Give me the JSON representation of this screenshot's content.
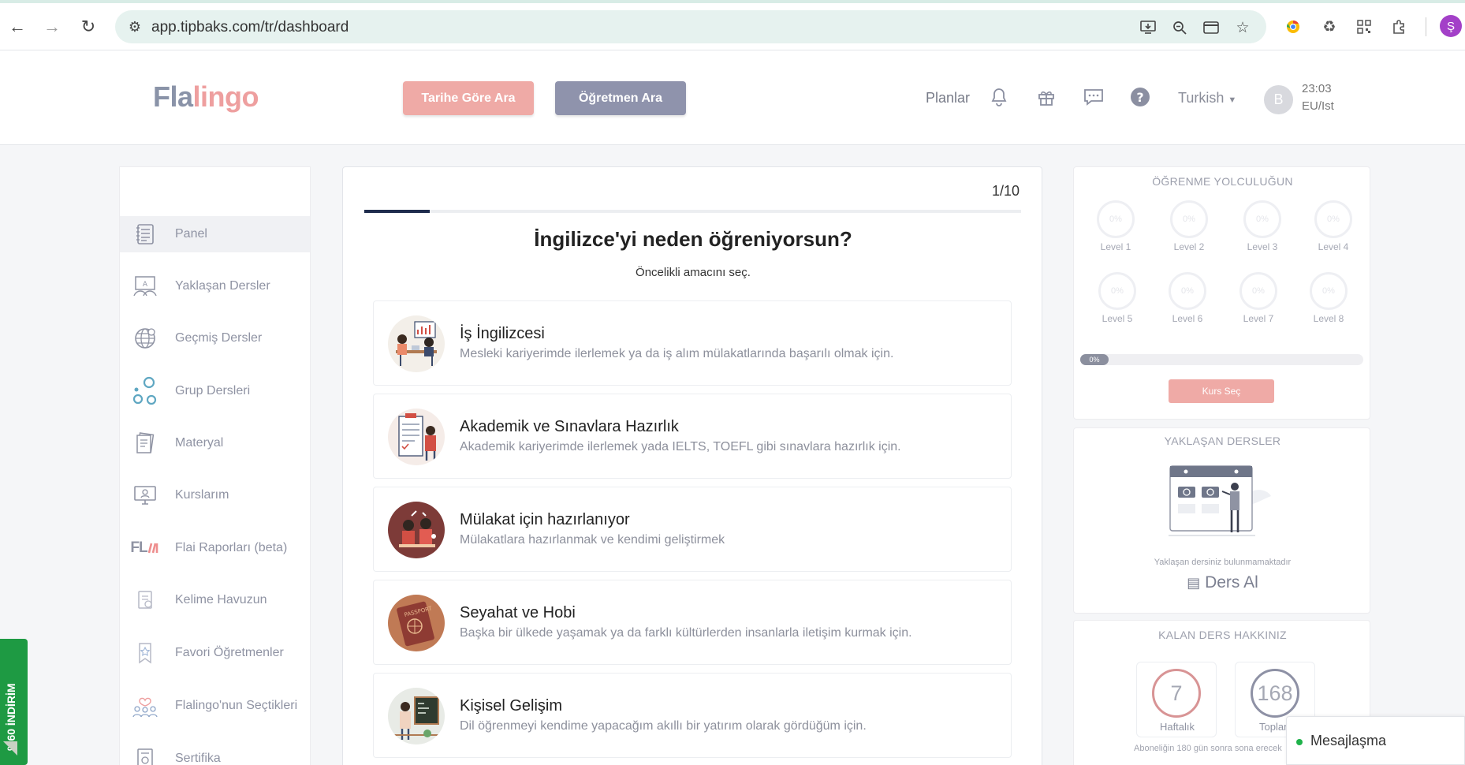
{
  "browser": {
    "url": "app.tipbaks.com/tr/dashboard",
    "profile_initial": "Ş"
  },
  "header": {
    "logo_part1": "Fla",
    "logo_part2": "lingo",
    "search_by_date": "Tarihe Göre Ara",
    "search_teacher": "Öğretmen Ara",
    "plans": "Planlar",
    "language": "Turkish",
    "avatar_initial": "B",
    "time": "23:03",
    "timezone": "EU/Ist"
  },
  "sidebar": {
    "items": [
      {
        "label": "Panel",
        "icon": "dashboard-icon"
      },
      {
        "label": "Yaklaşan Dersler",
        "icon": "upcoming-lessons-icon"
      },
      {
        "label": "Geçmiş Dersler",
        "icon": "past-lessons-icon"
      },
      {
        "label": "Grup Dersleri",
        "icon": "group-lessons-icon"
      },
      {
        "label": "Materyal",
        "icon": "material-icon"
      },
      {
        "label": "Kurslarım",
        "icon": "my-courses-icon"
      },
      {
        "label": "Flai Raporları (beta)",
        "icon": "flai-icon"
      },
      {
        "label": "Kelime Havuzun",
        "icon": "word-pool-icon"
      },
      {
        "label": "Favori Öğretmenler",
        "icon": "favorite-teachers-icon"
      },
      {
        "label": "Flalingo'nun Seçtikleri",
        "icon": "picks-icon"
      },
      {
        "label": "Sertifika",
        "icon": "certificate-icon"
      }
    ],
    "flai_logo_text": "FL"
  },
  "survey": {
    "counter": "1/10",
    "progress": 0.1,
    "question": "İngilizce'yi neden öğreniyorsun?",
    "subtitle": "Öncelikli amacını seç.",
    "options": [
      {
        "title": "İş İngilizcesi",
        "desc": "Mesleki kariyerimde ilerlemek ya da iş alım mülakatlarında başarılı olmak için."
      },
      {
        "title": "Akademik ve Sınavlara Hazırlık",
        "desc": "Akademik kariyerimde ilerlemek yada IELTS, TOEFL gibi sınavlara hazırlık için."
      },
      {
        "title": "Mülakat için hazırlanıyor",
        "desc": "Mülakatlara hazırlanmak ve kendimi geliştirmek"
      },
      {
        "title": "Seyahat ve Hobi",
        "desc": "Başka bir ülkede yaşamak ya da farklı kültürlerden insanlarla iletişim kurmak için."
      },
      {
        "title": "Kişisel Gelişim",
        "desc": "Dil öğrenmeyi kendime yapacağım akıllı bir yatırım olarak gördüğüm için."
      }
    ]
  },
  "journey": {
    "title": "ÖĞRENME YOLCULUĞUN",
    "levels": [
      {
        "label": "Level 1",
        "pct": "0%"
      },
      {
        "label": "Level 2",
        "pct": "0%"
      },
      {
        "label": "Level 3",
        "pct": "0%"
      },
      {
        "label": "Level 4",
        "pct": "0%"
      },
      {
        "label": "Level 5",
        "pct": "0%"
      },
      {
        "label": "Level 6",
        "pct": "0%"
      },
      {
        "label": "Level 7",
        "pct": "0%"
      },
      {
        "label": "Level 8",
        "pct": "0%"
      }
    ],
    "overall_pct": "0%",
    "select_course": "Kurs Seç"
  },
  "upcoming": {
    "title": "YAKLAŞAN DERSLER",
    "empty_text": "Yaklaşan dersiniz bulunmamaktadır",
    "take_lesson": "Ders Al"
  },
  "remaining": {
    "title": "KALAN DERS HAKKINIZ",
    "weekly_value": "7",
    "weekly_label": "Haftalık",
    "total_value": "168",
    "total_label": "Toplam",
    "note": "Aboneliğin 180 gün sonra sona erecek"
  },
  "discount": {
    "label": "%60 İNDİRİM"
  },
  "chat": {
    "label": "Mesajlaşma"
  }
}
